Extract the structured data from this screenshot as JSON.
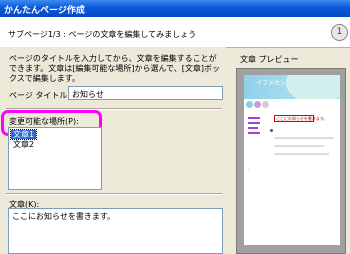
{
  "window": {
    "title": "かんたんページ作成"
  },
  "header": {
    "subtitle": "サブページ1/3 : ページの文章を編集してみましょう",
    "help_label": "1"
  },
  "panel": {
    "description": "ページのタイトルを入力してから、文章を編集することができます。文章は[編集可能な場所]から選んで、[文章]ボックスで編集します。",
    "page_title_label": "ページ タイトル(T):",
    "page_title_value": "お知らせ",
    "editable_label": "変更可能な場所(P):",
    "editable_items": [
      {
        "label": "文章1",
        "selected": true
      },
      {
        "label": "文章2",
        "selected": false
      }
    ],
    "text_label": "文章(K):",
    "text_value": "ここにお知らせを書きます。"
  },
  "preview": {
    "title": "文章 プレビュー",
    "banner_text": "イフメセン",
    "red_box_text": "ここにお知らせを書きます。"
  },
  "colors": {
    "title_bar": "#0a58d8",
    "highlight": "#ff00ff",
    "selection": "#316ac5"
  }
}
